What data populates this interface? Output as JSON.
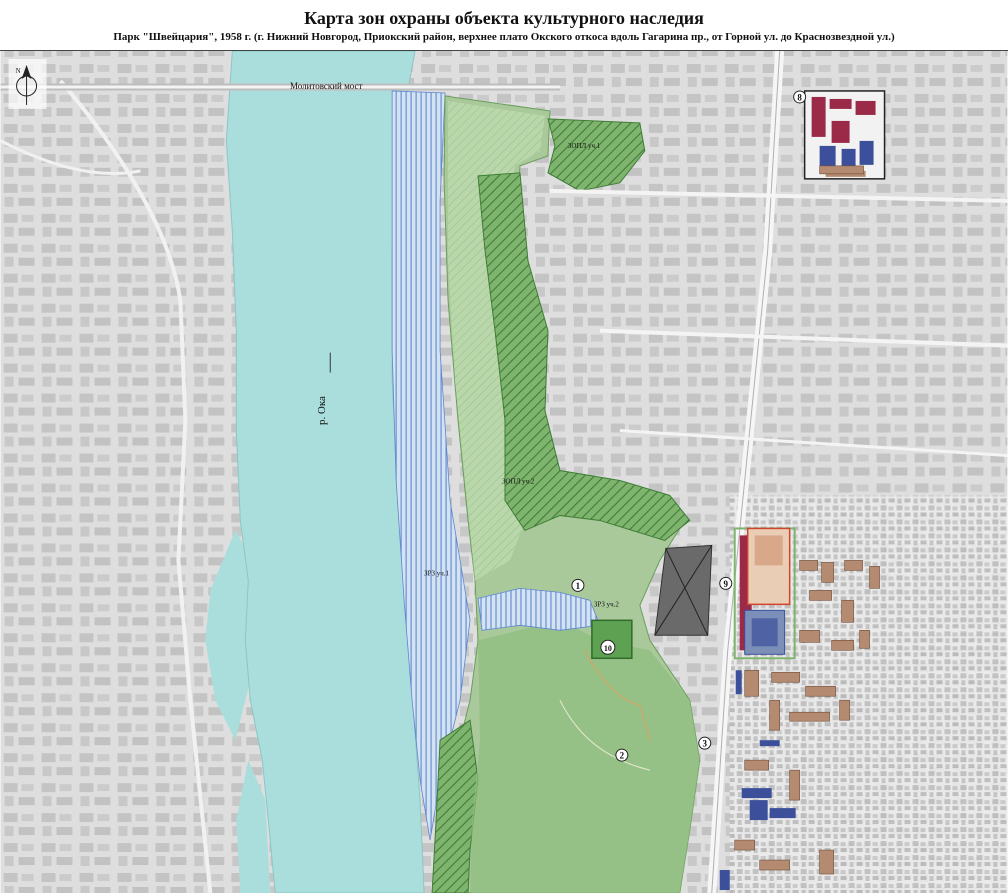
{
  "title": "Карта зон охраны объекта культурного наследия",
  "subtitle": "Парк \"Швейцария\", 1958 г. (г. Нижний Новгород, Приокский район, верхнее плато Окского откоса вдоль Гагарина пр., от Горной ул. до Краснозвездной ул.)",
  "labels": {
    "bridge": "Молитовский мост",
    "river": "р. Ока",
    "zopl1": "ЗОПЛ уч.1",
    "zopl2": "ЗОПЛ уч.2",
    "zrz1": "ЗРЗ уч.1",
    "zrz2": "ЗРЗ уч.2"
  },
  "markers": [
    "1",
    "2",
    "3",
    "8",
    "9",
    "10"
  ],
  "compass": {
    "icon": "north-arrow-icon",
    "letter": "N"
  },
  "colors": {
    "water": "#a9dedc",
    "land": "#d9d9d9",
    "block": "#c6c6c6",
    "road": "#f4f4f4",
    "green_zone": "#79b06a",
    "hatch": "#4d8c42",
    "blue_stripes": "#5f86d0",
    "heritage_red": "#9a2a48",
    "heritage_blue": "#3c4f9a",
    "building_brown": "#b48a70"
  }
}
